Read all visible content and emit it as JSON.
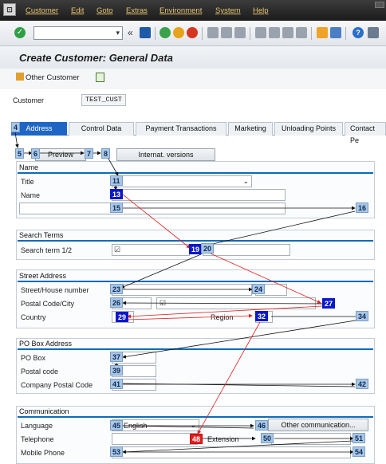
{
  "menu": {
    "items": [
      "Customer",
      "Edit",
      "Goto",
      "Extras",
      "Environment",
      "System",
      "Help"
    ]
  },
  "toolbar": {
    "command_field_value": "",
    "back_symbol": "«"
  },
  "title": "Create Customer: General Data",
  "app_toolbar": {
    "other_customer_label": "Other Customer"
  },
  "customer": {
    "label": "Customer",
    "value": "TEST_CUST"
  },
  "tabs": [
    "Address",
    "Control Data",
    "Payment Transactions",
    "Marketing",
    "Unloading Points",
    "Contact Pe"
  ],
  "address_toolbar": {
    "preview_label": "Preview",
    "intl_versions_label": "Internat. versions"
  },
  "groups": {
    "name": {
      "title": "Name",
      "title_label": "Title",
      "name_label": "Name"
    },
    "search_terms": {
      "title": "Search Terms",
      "search_term_label": "Search term 1/2"
    },
    "street_address": {
      "title": "Street Address",
      "street_label": "Street/House number",
      "postal_city_label": "Postal Code/City",
      "country_label": "Country",
      "region_label": "Region"
    },
    "po_box": {
      "title": "PO Box Address",
      "po_box_label": "PO Box",
      "postal_code_label": "Postal code",
      "company_postal_label": "Company Postal Code"
    },
    "communication": {
      "title": "Communication",
      "language_label": "Language",
      "language_value": "English",
      "other_comm_label": "Other communication...",
      "telephone_label": "Telephone",
      "extension_label": "Extension",
      "mobile_label": "Mobile Phone"
    }
  },
  "badges": [
    "4",
    "5",
    "6",
    "7",
    "8",
    "11",
    "13",
    "15",
    "16",
    "19",
    "20",
    "23",
    "24",
    "26",
    "27",
    "29",
    "32",
    "34",
    "37",
    "39",
    "41",
    "42",
    "45",
    "46",
    "48",
    "50",
    "51",
    "53",
    "54"
  ],
  "colors": {
    "menubar": "#2a2a2a",
    "menu_text": "#e6c373",
    "active_tab": "#1f66c4",
    "group_line": "#0c6bb9",
    "badge": "#a9c7e6",
    "badge_highlight": "#0b18c9",
    "badge_red": "#e02020",
    "overlay_red": "#e02020"
  }
}
